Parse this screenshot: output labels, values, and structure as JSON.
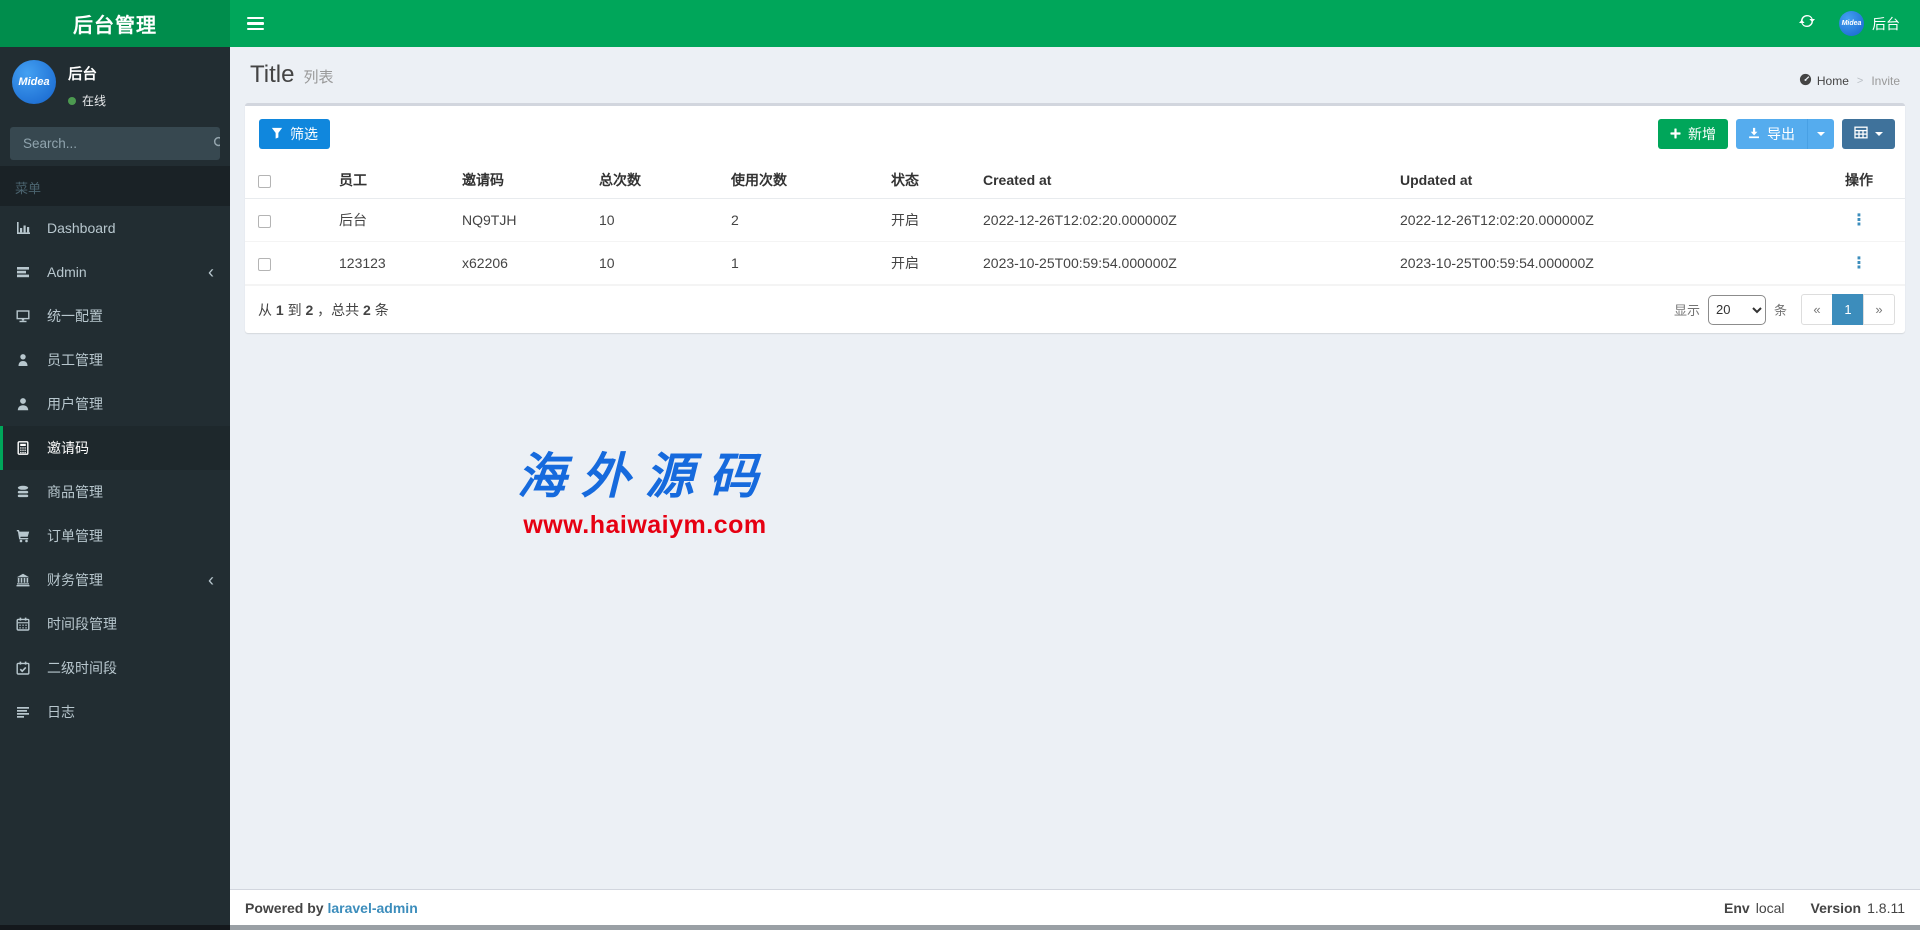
{
  "colors": {
    "navbar_green": "#00a65a",
    "logo_green": "#008d4c",
    "sidebar_dark": "#222d32",
    "filter_blue": "#1087dd",
    "export_blue": "#55acee",
    "columns_blue": "#3f729b",
    "pagination_active_blue": "#3c8dbc",
    "watermark_blue": "#166add",
    "watermark_red": "#e60012",
    "online_green": "#4c9a50"
  },
  "header": {
    "logo_title": "后台管理",
    "user_name": "后台",
    "avatar_text": "Midea"
  },
  "sidebar": {
    "user": {
      "name": "后台",
      "status": "在线",
      "avatar_text": "Midea"
    },
    "search_placeholder": "Search...",
    "menu_header": "菜单",
    "items": [
      {
        "label": "Dashboard",
        "icon": "bar-chart-icon",
        "active": false,
        "has_children": false
      },
      {
        "label": "Admin",
        "icon": "tasks-icon",
        "active": false,
        "has_children": true
      },
      {
        "label": "统一配置",
        "icon": "desktop-icon",
        "active": false,
        "has_children": false
      },
      {
        "label": "员工管理",
        "icon": "user-md-icon",
        "active": false,
        "has_children": false
      },
      {
        "label": "用户管理",
        "icon": "user-icon",
        "active": false,
        "has_children": false
      },
      {
        "label": "邀请码",
        "icon": "calculator-icon",
        "active": true,
        "has_children": false
      },
      {
        "label": "商品管理",
        "icon": "database-icon",
        "active": false,
        "has_children": false
      },
      {
        "label": "订单管理",
        "icon": "cart-icon",
        "active": false,
        "has_children": false
      },
      {
        "label": "财务管理",
        "icon": "bank-icon",
        "active": false,
        "has_children": true
      },
      {
        "label": "时间段管理",
        "icon": "calendar-icon",
        "active": false,
        "has_children": false
      },
      {
        "label": "二级时间段",
        "icon": "calendar-check-icon",
        "active": false,
        "has_children": false
      },
      {
        "label": "日志",
        "icon": "list-icon",
        "active": false,
        "has_children": false
      }
    ]
  },
  "content_header": {
    "title": "Title",
    "subtitle": "列表",
    "breadcrumb": [
      {
        "label": "Home",
        "icon": "dashboard-icon"
      },
      {
        "label": "Invite"
      }
    ]
  },
  "toolbar": {
    "filter_label": "筛选",
    "add_label": "新增",
    "export_label": "导出"
  },
  "table": {
    "columns": [
      "员工",
      "邀请码",
      "总次数",
      "使用次数",
      "状态",
      "Created at",
      "Updated at",
      "操作"
    ],
    "rows": [
      {
        "employee": "后台",
        "code": "NQ9TJH",
        "total": "10",
        "used": "2",
        "status": "开启",
        "created_at": "2022-12-26T12:02:20.000000Z",
        "updated_at": "2022-12-26T12:02:20.000000Z"
      },
      {
        "employee": "123123",
        "code": "x62206",
        "total": "10",
        "used": "1",
        "status": "开启",
        "created_at": "2023-10-25T00:59:54.000000Z",
        "updated_at": "2023-10-25T00:59:54.000000Z"
      }
    ]
  },
  "pagination": {
    "summary_parts": [
      "从 ",
      "1",
      " 到 ",
      "2",
      " ，总共 ",
      "2",
      " 条"
    ],
    "show_label": "显示",
    "per_page": "20",
    "unit_label": "条",
    "prev": "«",
    "page": "1",
    "next": "»"
  },
  "watermark": {
    "line1": "海外源码",
    "line2": "www.haiwaiym.com"
  },
  "footer": {
    "powered_by": "Powered by",
    "link": "laravel-admin",
    "env_label": "Env",
    "env_value": "local",
    "version_label": "Version",
    "version_value": "1.8.11"
  }
}
